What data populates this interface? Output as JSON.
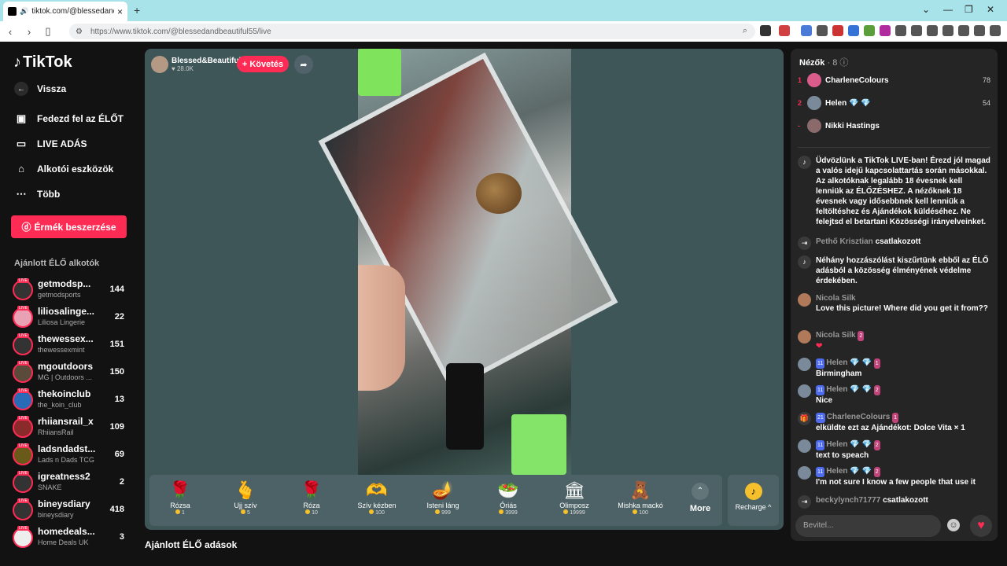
{
  "browser": {
    "tab_title": "tiktok.com/@blessedandbea",
    "url": "https://www.tiktok.com/@blessedandbeautiful55/live"
  },
  "sidebar": {
    "logo": "TikTok",
    "back": "Vissza",
    "items": [
      {
        "label": "Fedezd fel az ÉLŐT",
        "icon": "calendar-live-icon"
      },
      {
        "label": "LIVE ADÁS",
        "icon": "video-camera-icon"
      },
      {
        "label": "Alkotói eszközök",
        "icon": "creator-tools-icon"
      },
      {
        "label": "Több",
        "icon": "more-icon"
      }
    ],
    "coins_button": "Érmék beszerzése",
    "recommended_title": "Ajánlott ÉLŐ alkotók",
    "creators": [
      {
        "name": "getmodsp...",
        "sub": "getmodsports",
        "count": "144"
      },
      {
        "name": "liliosalinge...",
        "sub": "Liliosa Lingerie",
        "count": "22"
      },
      {
        "name": "thewessex...",
        "sub": "thewessexmint",
        "count": "151"
      },
      {
        "name": "mgoutdoors",
        "sub": "MG | Outdoors ...",
        "count": "150"
      },
      {
        "name": "thekoinclub",
        "sub": "the_koin_club",
        "count": "13"
      },
      {
        "name": "rhiiansrail_x",
        "sub": "RhiiansRail",
        "count": "109"
      },
      {
        "name": "ladsndadst...",
        "sub": "Lads n Dads TCG",
        "count": "69"
      },
      {
        "name": "igreatness2",
        "sub": "SNAKE",
        "count": "2"
      },
      {
        "name": "bineysdiary",
        "sub": "bineysdiary",
        "count": "418"
      },
      {
        "name": "homedeals...",
        "sub": "Home Deals UK",
        "count": "3"
      }
    ]
  },
  "stream": {
    "host_name": "Blessed&Beautiful",
    "host_likes": "♥ 28.0K",
    "follow": "+ Követés",
    "recommended_live": "Ajánlott ÉLŐ adások"
  },
  "gifts": [
    {
      "name": "Rózsa",
      "price": "1",
      "icon": "🌹"
    },
    {
      "name": "Ujj szív",
      "price": "5",
      "icon": "🫰"
    },
    {
      "name": "Róza",
      "price": "10",
      "icon": "🌹"
    },
    {
      "name": "Szív kézben",
      "price": "100",
      "icon": "🫶"
    },
    {
      "name": "Isteni láng",
      "price": "999",
      "icon": "🪔"
    },
    {
      "name": "Óriás",
      "price": "3999",
      "icon": "🥗"
    },
    {
      "name": "Olimposz",
      "price": "19999",
      "icon": "🏛"
    },
    {
      "name": "Mishka mackó",
      "price": "100",
      "icon": "🧸"
    }
  ],
  "gift_more": "More",
  "recharge": "Recharge ^",
  "chat": {
    "viewers_title": "Nézők",
    "viewers_count": "· 8",
    "viewers": [
      {
        "rank": "1",
        "name": "CharleneColours",
        "score": "78"
      },
      {
        "rank": "2",
        "name": "Helen 💎 💎",
        "score": "54"
      },
      {
        "rank": "-",
        "name": "Nikki Hastings",
        "score": ""
      }
    ],
    "messages": [
      {
        "who": "",
        "text": "Üdvözlünk a TikTok LIVE-ban! Érezd jól magad a valós idejű kapcsolattartás során másokkal. Az alkotóknak legalább 18 évesnek kell lenniük az ÉLŐZÉSHEZ. A nézőknek 18 évesnek vagy idősebbnek kell lenniük a feltöltéshez és Ajándékok küldéséhez. Ne felejtsd el betartani Közösségi irányelveinket."
      },
      {
        "who": "Pethő Krisztian",
        "text": "csatlakozott"
      },
      {
        "who": "",
        "text": "Néhány hozzászólást kiszűrtünk ebből az ÉLŐ adásból a közösség élményének védelme érdekében."
      },
      {
        "who": "Nicola Silk",
        "text": "Love this picture! Where did you get it from??"
      },
      {
        "who": "Nicola Silk",
        "text": "❤"
      },
      {
        "who": "Helen 💎 💎",
        "text": "Birmingham"
      },
      {
        "who": "Helen 💎 💎",
        "text": "Nice"
      },
      {
        "who": "CharleneColours",
        "text": "elküldte ezt az Ajándékot: Dolce Vita × 1"
      },
      {
        "who": "Helen 💎 💎",
        "text": "text to speach"
      },
      {
        "who": "Helen 💎 💎",
        "text": "I'm not sure I know a few people that use it"
      },
      {
        "who": "beckylynch71777",
        "text": "csatlakozott"
      }
    ],
    "input_placeholder": "Bevitel..."
  }
}
